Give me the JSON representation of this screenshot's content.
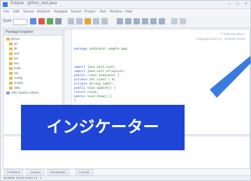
{
  "window": {
    "title": "Eclipse - jython_test.java"
  },
  "menu": [
    "File",
    "Edit",
    "Source",
    "Refactor",
    "Navigate",
    "Search",
    "Project",
    "Run",
    "Window",
    "Help"
  ],
  "toolbar": {
    "search_label": "Quick"
  },
  "project_panel": {
    "title": "Package Explorer",
    "items": [
      "jython",
      "src",
      "lib",
      "test",
      "bin",
      "doc",
      "build",
      "res",
      "config",
      "scripts",
      "data",
      "JRE System Library"
    ]
  },
  "editor": {
    "comments": [
      "/* Indicator.java */",
      "Copyright 2012 (c) - Sample source"
    ],
    "code": [
      {
        "kw": "package",
        "txt": "indicator.sample.app;"
      },
      {
        "kw": "import",
        "txt": "java.util.List;"
      },
      {
        "kw": "import",
        "txt": "java.util.ArrayList;"
      },
      {
        "kw": "public",
        "txt": "class Indicator {"
      },
      {
        "kw": "private",
        "txt": "int count = 0;"
      },
      {
        "kw": "private",
        "txt": "String label;"
      },
      {
        "kw": "public",
        "txt": "void update() {"
      },
      {
        "kw": "return",
        "txt": "count;"
      },
      {
        "kw": "public",
        "txt": "void show() {"
      },
      {
        "kw": "}",
        "txt": ""
      }
    ]
  },
  "bottom_tabs": [
    "Problems",
    "Javadoc",
    "Declaration",
    "Console"
  ],
  "status": {
    "text": "Writable   Smart Insert   12 : 1"
  },
  "banner": {
    "text": "インジケーター"
  },
  "colors": {
    "banner": "#1f45d6",
    "arrow": "#3a7be0"
  }
}
